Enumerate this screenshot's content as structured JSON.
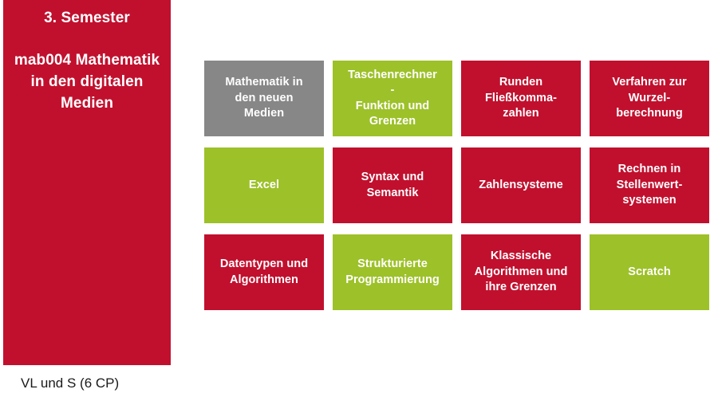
{
  "colors": {
    "red": "#C1102E",
    "green": "#9DC129",
    "grey": "#878787",
    "text_on_tile": "#FFFFFF",
    "caption_text": "#1A1A1A"
  },
  "semester_panel": {
    "semester_label": "3. Semester",
    "module_code_and_title": "mab004\nMathematik in\nden digitalen\nMedien"
  },
  "caption": {
    "credits_label": "VL und S (6 CP)"
  },
  "grid": {
    "columns": 4,
    "rows": 3,
    "tiles": [
      {
        "label": "Mathematik in\nden neuen\nMedien",
        "color": "grey"
      },
      {
        "label": "Taschenrechner\n-\nFunktion und\nGrenzen",
        "color": "green"
      },
      {
        "label": "Runden\nFließkomma-\nzahlen",
        "color": "red"
      },
      {
        "label": "Verfahren zur\nWurzel-\nberechnung",
        "color": "red"
      },
      {
        "label": "Excel",
        "color": "green"
      },
      {
        "label": "Syntax und\nSemantik",
        "color": "red"
      },
      {
        "label": "Zahlensysteme",
        "color": "red"
      },
      {
        "label": "Rechnen in\nStellenwert-\nsystemen",
        "color": "red"
      },
      {
        "label": "Datentypen und\nAlgorithmen",
        "color": "red"
      },
      {
        "label": "Strukturierte\nProgrammierung",
        "color": "green"
      },
      {
        "label": "Klassische\nAlgorithmen und\nihre Grenzen",
        "color": "red"
      },
      {
        "label": "Scratch",
        "color": "green"
      }
    ]
  }
}
